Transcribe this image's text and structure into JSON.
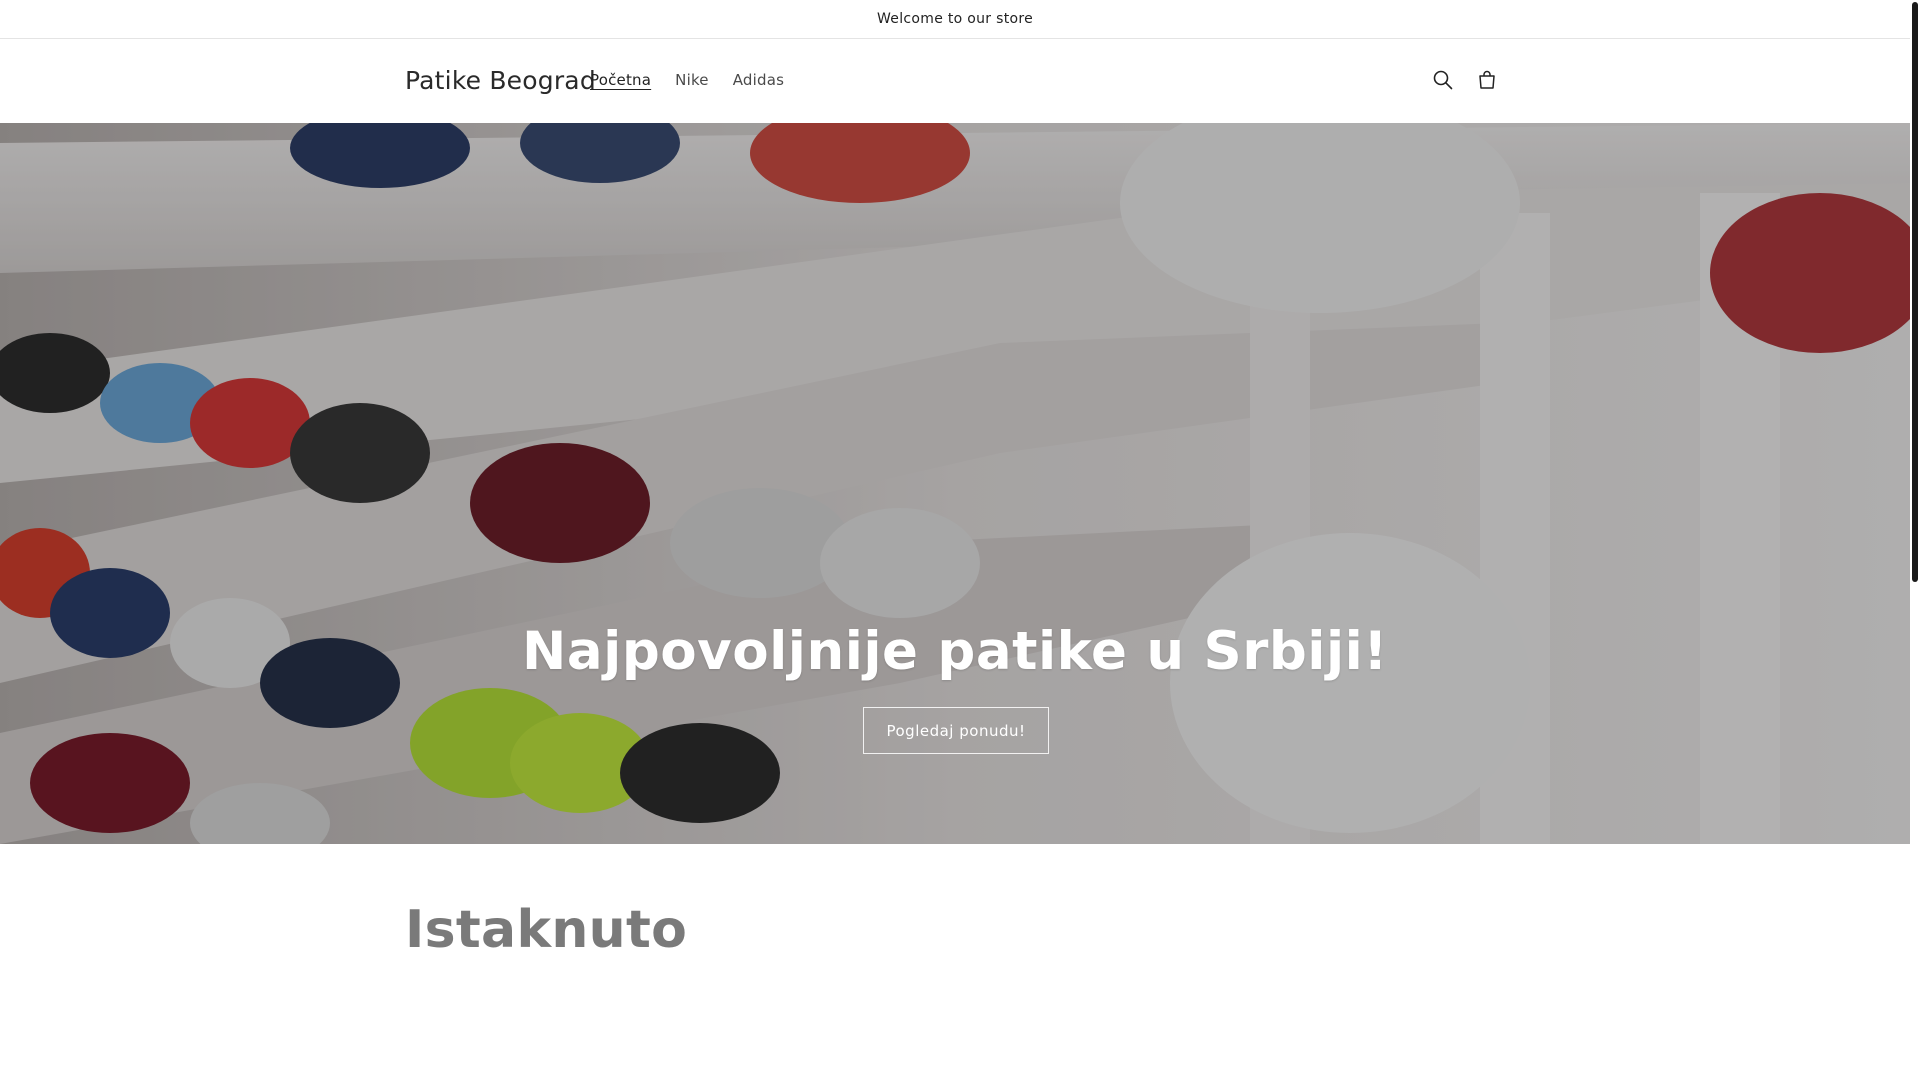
{
  "announcement": {
    "text": "Welcome to our store"
  },
  "header": {
    "logo": "Patike Beograd",
    "nav": [
      {
        "label": "Početna",
        "active": true
      },
      {
        "label": "Nike",
        "active": false
      },
      {
        "label": "Adidas",
        "active": false
      }
    ],
    "icons": {
      "search": "search-icon",
      "cart": "cart-icon"
    }
  },
  "hero": {
    "title": "Najpovoljnije patike u Srbiji!",
    "button_label": "Pogledaj ponudu!",
    "image": "sneakers-shelf-photo"
  },
  "featured": {
    "title": "Istaknuto"
  },
  "colors": {
    "text": "#121212",
    "hero_overlay": "#000000",
    "scrollbar_thumb": "#1a1a1a"
  }
}
